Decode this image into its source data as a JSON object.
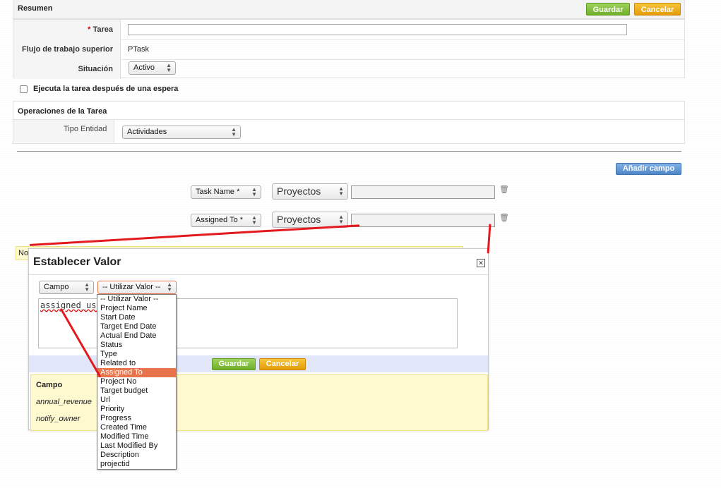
{
  "summary": {
    "title": "Resumen",
    "save_label": "Guardar",
    "cancel_label": "Cancelar"
  },
  "form": {
    "task_label": "Tarea",
    "required_mark": "*",
    "task_value": "",
    "parent_label": "Flujo de trabajo superior",
    "parent_value": "PTask",
    "status_label": "Situación",
    "status_value": "Activo"
  },
  "wait_checkbox": {
    "label": "Ejecuta la tarea después de una espera",
    "checked": false
  },
  "operations": {
    "title": "Operaciones de la Tarea",
    "entity_label": "Tipo Entidad",
    "entity_value": "Actividades"
  },
  "add_field_label": "Añadir campo",
  "field_rows": [
    {
      "field": "Task Name *",
      "module": "Proyectos",
      "value": ""
    },
    {
      "field": "Assigned To *",
      "module": "Proyectos",
      "value": ""
    }
  ],
  "partial_note": "No",
  "modal": {
    "title": "Establecer Valor",
    "type_select": "Campo",
    "value_select": "-- Utilizar Valor --",
    "textarea_value": "assigned_use",
    "save_label": "Guardar",
    "cancel_label": "Cancelar",
    "fields_header": "Campo",
    "fields": [
      "annual_revenue",
      "notify_owner"
    ]
  },
  "dropdown": {
    "selected": "Assigned To",
    "options": [
      "-- Utilizar Valor --",
      "Project Name",
      "Start Date",
      "Target End Date",
      "Actual End Date",
      "Status",
      "Type",
      "Related to",
      "Assigned To",
      "Project No",
      "Target budget",
      "Url",
      "Priority",
      "Progress",
      "Created Time",
      "Modified Time",
      "Last Modified By",
      "Description",
      "projectid"
    ]
  },
  "colors": {
    "save": "#6fae2a",
    "cancel": "#e39b08",
    "add_field": "#4f86c6",
    "highlight": "#e8744c",
    "annotation": "#e3191e"
  }
}
